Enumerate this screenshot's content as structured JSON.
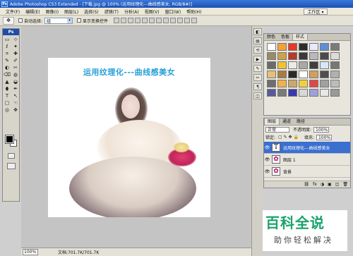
{
  "window": {
    "title": "Adobe Photoshop CS3 Extended - [下载.jpg @ 100% (运用纹理化---曲线感美女, RGB/8#)]",
    "app_badge": "Ps"
  },
  "menu": {
    "items": [
      "文件(F)",
      "编辑(E)",
      "图像(I)",
      "图层(L)",
      "选择(S)",
      "滤镜(T)",
      "分析(A)",
      "视图(V)",
      "窗口(W)",
      "帮助(H)"
    ],
    "workspace_label": "工作区 ▾"
  },
  "options": {
    "auto_select_label": "自动选择:",
    "auto_select_value": "组",
    "show_transform_label": "显示变换控件"
  },
  "toolbox": {
    "logo": "Ps",
    "tools": [
      "▭",
      "⊹",
      "ℓ",
      "✦",
      "⌗",
      "✚",
      "✎",
      "✐",
      "◐",
      "✂",
      "⌫",
      "◍",
      "▲",
      "◒",
      "⬮",
      "✒",
      "T",
      "↖",
      "▢",
      "☜",
      "◎",
      "✥"
    ]
  },
  "canvas": {
    "text_layer_title": "运用纹理化---曲线感美女"
  },
  "status": {
    "zoom": "100%",
    "doc": "文档:701.7K/701.7K"
  },
  "swatch_panel": {
    "tabs": [
      "颜色",
      "色板",
      "样式"
    ],
    "active_tab": 2,
    "swatches": [
      "#ffffff",
      "#f6a03a",
      "#e23b2a",
      "#2d2d2d",
      "#e8e8ff",
      "#5b8fd8",
      "#7b7b7b",
      "#9a8a6c",
      "#cfa24a",
      "#b73a24",
      "#3a3a3a",
      "#b9b9b9",
      "#4a4a4a",
      "#dcdcdc",
      "#6b6b6b",
      "#f1c232",
      "#eaeaea",
      "#a8a8a8",
      "#3f3f3f",
      "#d6e8f8",
      "#777777",
      "#e6c07a",
      "#a97b44",
      "#2b2b2b",
      "#ffffff",
      "#d0a060",
      "#4f4f4f",
      "#b0b0b0",
      "#6e6e6e",
      "#f3b04a",
      "#c9a86a",
      "#f0d040",
      "#e04848",
      "#a0a0a0",
      "#bcbcbc",
      "#5a5a9a",
      "#7a7a7a",
      "#3a3ab0",
      "#d8d8d8",
      "#a0a0d8",
      "#e8e8e8",
      "#9a9a9a"
    ]
  },
  "layers_panel": {
    "tabs": [
      "图层",
      "通道",
      "路径"
    ],
    "blend_mode": "正常",
    "opacity_label": "不透明度:",
    "opacity_value": "100%",
    "lock_label": "锁定:",
    "fill_label": "填充:",
    "fill_value": "100%",
    "layers": [
      {
        "name": "运用纹理化---曲线感美女",
        "thumb": "T",
        "selected": true
      },
      {
        "name": "图层 1",
        "thumb": "✿",
        "selected": false
      },
      {
        "name": "背景",
        "thumb": "✿",
        "selected": false
      }
    ],
    "bottom_icons": [
      "⛓",
      "fx",
      "◑",
      "▣",
      "◫",
      "🗑"
    ]
  },
  "watermark": {
    "title": "百科全说",
    "subtitle": "助你轻松解决"
  }
}
